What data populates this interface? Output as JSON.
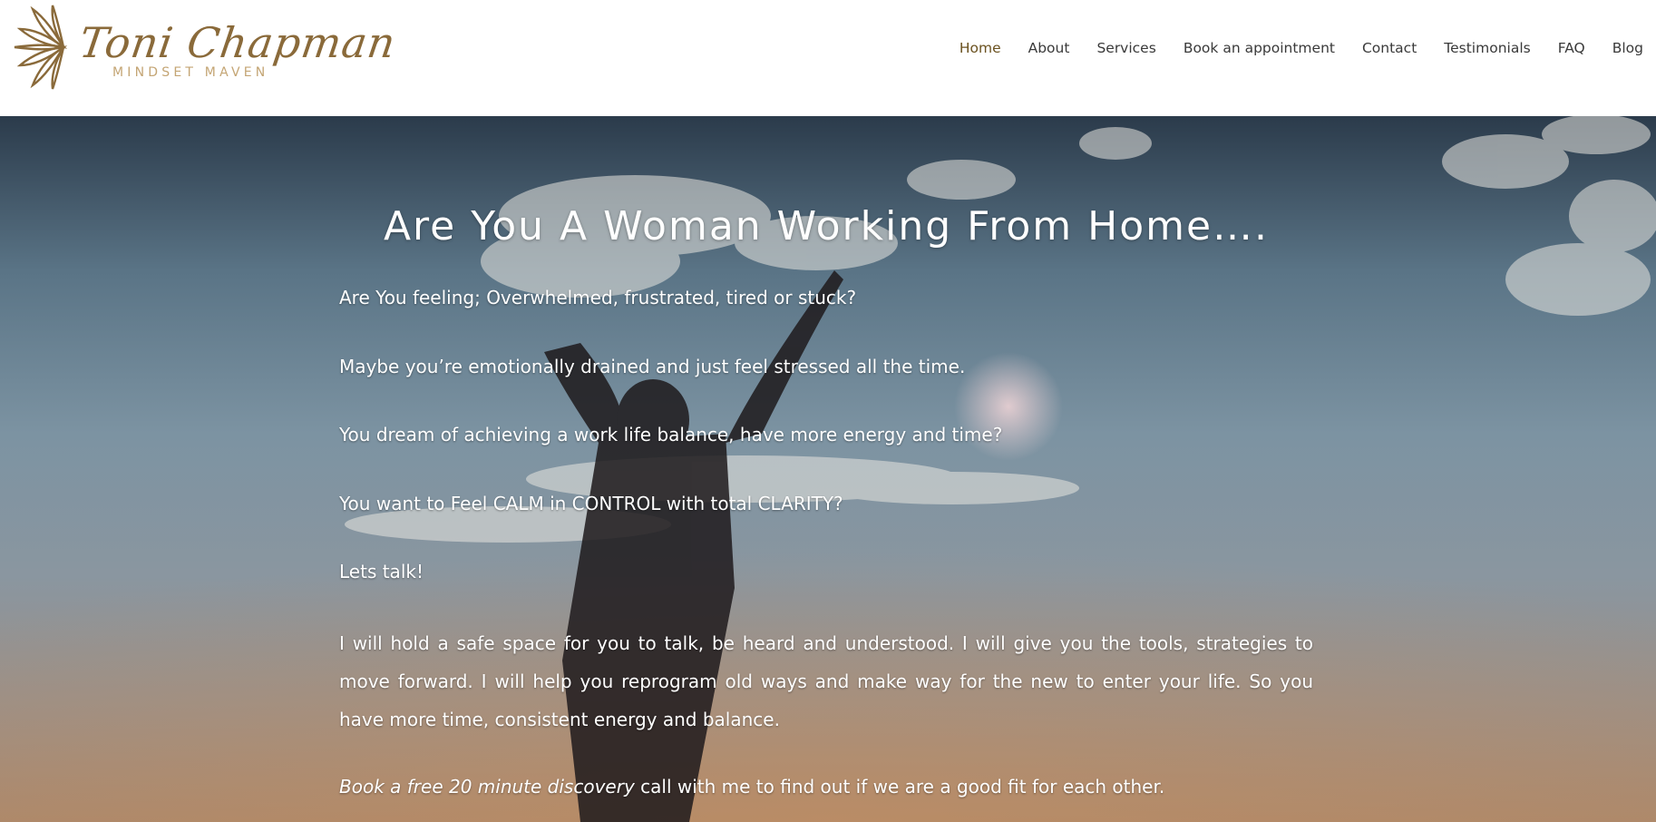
{
  "header": {
    "logo": {
      "name": "Toni Chapman",
      "tagline": "MINDSET MAVEN",
      "icon": "lotus-mandala-icon",
      "color": "#8a6a3a"
    },
    "nav": {
      "items": [
        {
          "label": "Home",
          "active": true
        },
        {
          "label": "About",
          "active": false
        },
        {
          "label": "Services",
          "active": false
        },
        {
          "label": "Book an appointment",
          "active": false
        },
        {
          "label": "Contact",
          "active": false
        },
        {
          "label": "Testimonials",
          "active": false
        },
        {
          "label": "FAQ",
          "active": false
        },
        {
          "label": "Blog",
          "active": false
        }
      ]
    }
  },
  "hero": {
    "background": "photo-woman-arms-raised-sky",
    "title": "Are You A Woman Working From Home….",
    "paragraphs": [
      "Are You feeling; Overwhelmed, frustrated, tired or stuck?",
      "Maybe you’re emotionally drained and just feel stressed all the time.",
      "You dream of achieving a work life balance, have more energy and time?",
      "You want to Feel CALM in CONTROL with total CLARITY?",
      "Lets talk!",
      "I  will hold a safe space for you to talk, be heard and understood. I will give you the tools, strategies  to move forward. I will help you reprogram old ways and make way for the new to enter your life. So you have more time, consistent energy and balance."
    ],
    "cta": {
      "link_text": "Book a free 20 minute discovery",
      "rest_text": " call with me to find out if we are a good fit for each other."
    }
  }
}
